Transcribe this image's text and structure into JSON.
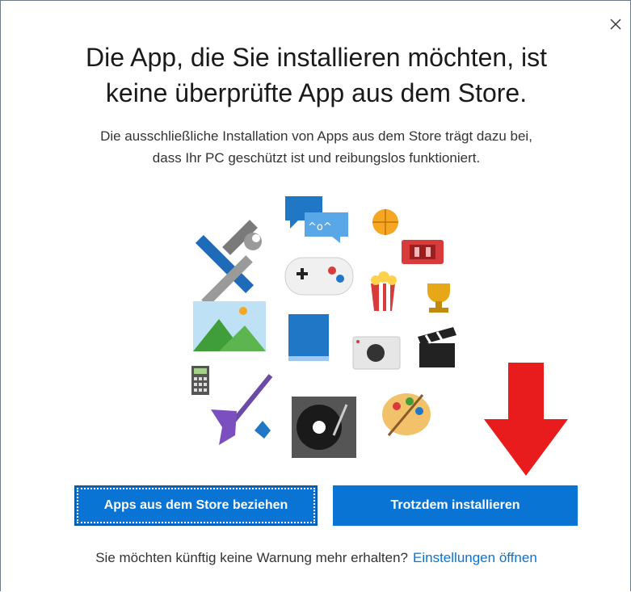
{
  "dialog": {
    "title_line1": "Die App, die Sie installieren möchten, ist",
    "title_line2": "keine überprüfte App aus dem Store.",
    "desc_line1": "Die ausschließliche Installation von Apps aus dem Store trägt dazu bei,",
    "desc_line2": "dass Ihr PC geschützt ist und reibungslos funktioniert.",
    "close_icon": "close-icon"
  },
  "buttons": {
    "store_label": "Apps aus dem Store beziehen",
    "install_label": "Trotzdem installieren"
  },
  "footer": {
    "text": "Sie möchten künftig keine Warnung mehr erhalten?",
    "link": "Einstellungen öffnen"
  },
  "colors": {
    "accent": "#0a74d4",
    "annotation_arrow": "#e81c1c"
  }
}
